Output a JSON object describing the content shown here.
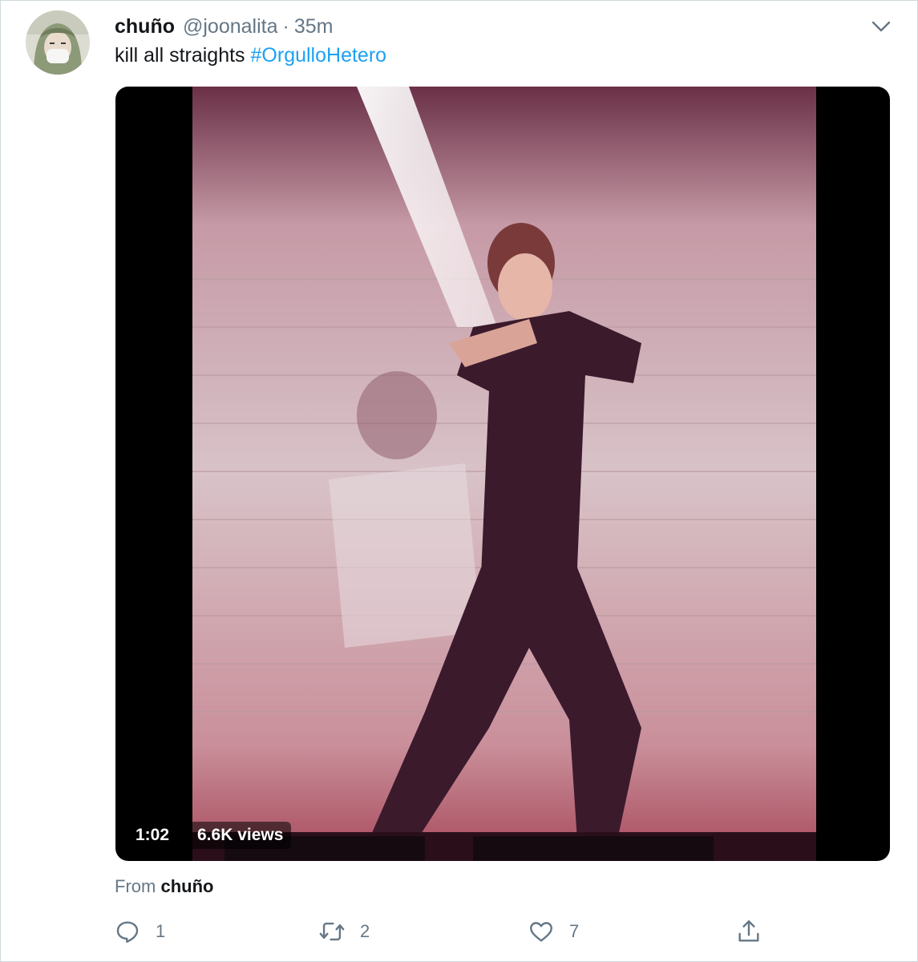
{
  "tweet": {
    "display_name": "chuño",
    "handle": "@joonalita",
    "separator": "·",
    "time": "35m",
    "text": "kill all straights",
    "hashtag": "#OrgulloHetero",
    "avatar_icon": "avatar-masked-user"
  },
  "media": {
    "duration": "1:02",
    "views": "6.6K views"
  },
  "source": {
    "prefix": "From",
    "name": "chuño"
  },
  "actions": {
    "reply_count": "1",
    "retweet_count": "2",
    "like_count": "7"
  },
  "colors": {
    "accent": "#1da1f2",
    "muted": "#657786",
    "text": "#14171a"
  }
}
